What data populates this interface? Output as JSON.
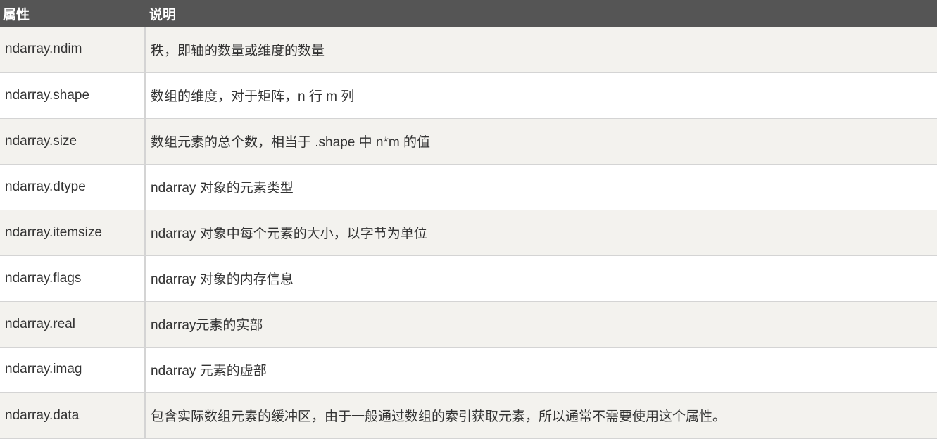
{
  "headers": [
    "属性",
    "说明"
  ],
  "rows": [
    {
      "attr": "ndarray.ndim",
      "desc": "秩，即轴的数量或维度的数量"
    },
    {
      "attr": "ndarray.shape",
      "desc": "数组的维度，对于矩阵，n 行 m 列"
    },
    {
      "attr": "ndarray.size",
      "desc": "数组元素的总个数，相当于 .shape 中 n*m 的值"
    },
    {
      "attr": "ndarray.dtype",
      "desc": "ndarray 对象的元素类型"
    },
    {
      "attr": "ndarray.itemsize",
      "desc": "ndarray 对象中每个元素的大小，以字节为单位"
    },
    {
      "attr": "ndarray.flags",
      "desc": "ndarray 对象的内存信息"
    },
    {
      "attr": "ndarray.real",
      "desc": "ndarray元素的实部"
    },
    {
      "attr": "ndarray.imag",
      "desc": "ndarray 元素的虚部"
    },
    {
      "attr": "ndarray.data",
      "desc": "包含实际数组元素的缓冲区，由于一般通过数组的索引获取元素，所以通常不需要使用这个属性。"
    }
  ]
}
